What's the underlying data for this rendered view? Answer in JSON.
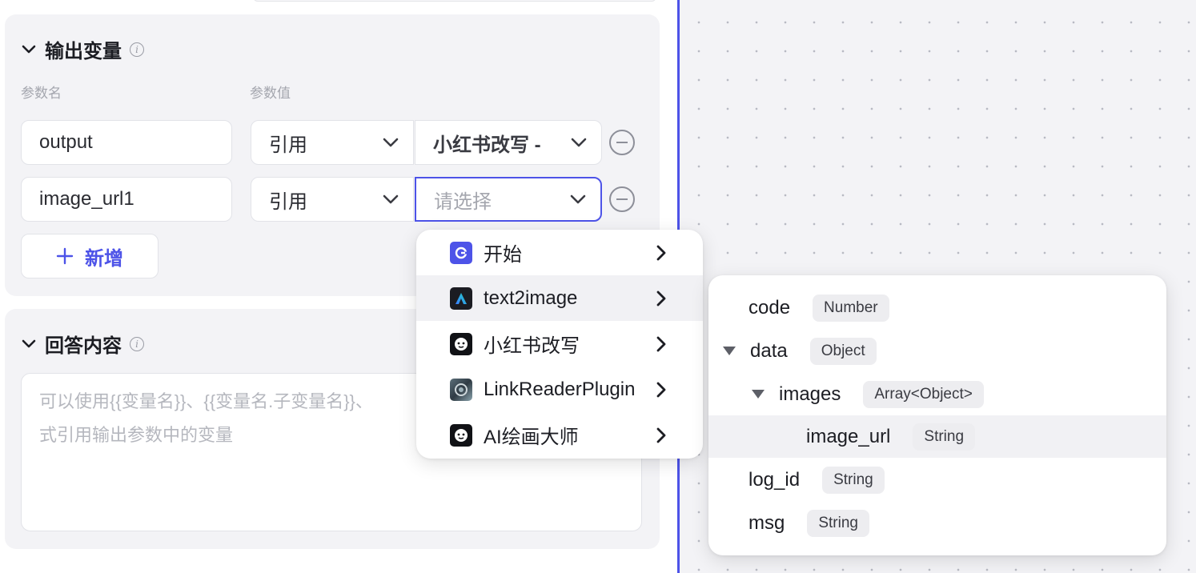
{
  "output_section": {
    "title": "输出变量",
    "col_name": "参数名",
    "col_value": "参数值",
    "rows": [
      {
        "name": "output",
        "type": "引用",
        "value": "小红书改写 -",
        "value_is_placeholder": false
      },
      {
        "name": "image_url1",
        "type": "引用",
        "value": "请选择",
        "value_is_placeholder": true
      }
    ],
    "add_label": "新增"
  },
  "answer_section": {
    "title": "回答内容",
    "placeholder_line1": "可以使用{{变量名}}、{{变量名.子变量名}}、",
    "placeholder_line2": "式引用输出参数中的变量"
  },
  "dropdown": {
    "items": [
      {
        "label": "开始",
        "icon": "start-node-icon"
      },
      {
        "label": "text2image",
        "icon": "text2image-icon"
      },
      {
        "label": "小红书改写",
        "icon": "robot-icon"
      },
      {
        "label": "LinkReaderPlugin",
        "icon": "link-reader-icon"
      },
      {
        "label": "AI绘画大师",
        "icon": "robot-icon"
      }
    ],
    "hovered_index": 1
  },
  "subpanel": {
    "fields": [
      {
        "name": "code",
        "type": "Number"
      },
      {
        "name": "data",
        "type": "Object"
      },
      {
        "name": "images",
        "type": "Array<Object>"
      },
      {
        "name": "image_url",
        "type": "String"
      },
      {
        "name": "log_id",
        "type": "String"
      },
      {
        "name": "msg",
        "type": "String"
      }
    ],
    "hovered_index": 3
  },
  "colors": {
    "accent": "#4d53e8",
    "card_bg": "#f3f3f6",
    "badge_bg": "#ededf0"
  }
}
